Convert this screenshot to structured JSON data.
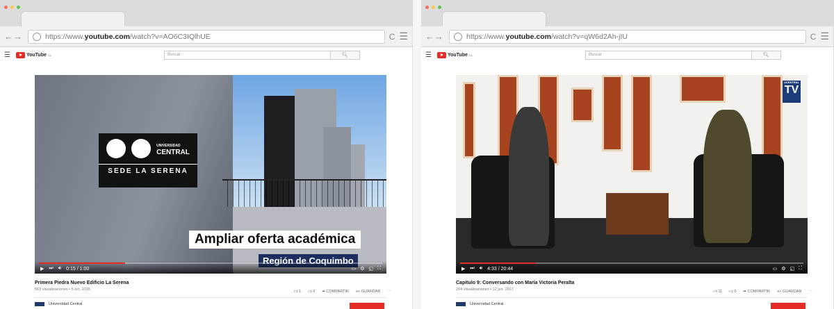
{
  "left": {
    "url": {
      "prefix": "https://www.",
      "host": "youtube.com",
      "path": "/watch?v=AO6C3IQlhUE"
    },
    "header": {
      "logo": "YouTube",
      "logo_suffix": "CL",
      "search_placeholder": "Buscar"
    },
    "video": {
      "overlay_line1": "Ampliar oferta académica",
      "overlay_line2": "Región de Coquimbo",
      "sign_brand_line1": "UNIVERSIDAD",
      "sign_brand_line2": "CENTRAL",
      "sign_sede": "SEDE LA SERENA",
      "time": "0:15 / 1:00",
      "progress": 0.25
    },
    "title": "Primera Piedra Nuevo Edificio La Serena",
    "meta": "563 visualizaciones • 5 oct. 2016",
    "likes": "1",
    "dislikes": "0",
    "share": "COMPARTIR",
    "save": "GUARDAR",
    "channel": "Universidad Central"
  },
  "right": {
    "url": {
      "prefix": "https://www.",
      "host": "youtube.com",
      "path": "/watch?v=qW6d2Ah-jIU"
    },
    "header": {
      "logo": "YouTube",
      "logo_suffix": "CL",
      "search_placeholder": "Buscar"
    },
    "video": {
      "logo_small": "UCENTRAL",
      "logo_big": "TV",
      "time": "4:33 / 20:44",
      "progress": 0.22
    },
    "title": "Capítulo 9: Conversando con María Victoria Peralta",
    "meta": "204 visualizaciones • 12 jun. 2017",
    "likes": "11",
    "dislikes": "0",
    "share": "COMPARTIR",
    "save": "GUARDAR",
    "channel": "Universidad Central"
  },
  "colors": {
    "youtube_red": "#e52d27",
    "ucentral_blue": "#1d2f5e",
    "studio_wood": "#a8431f"
  }
}
